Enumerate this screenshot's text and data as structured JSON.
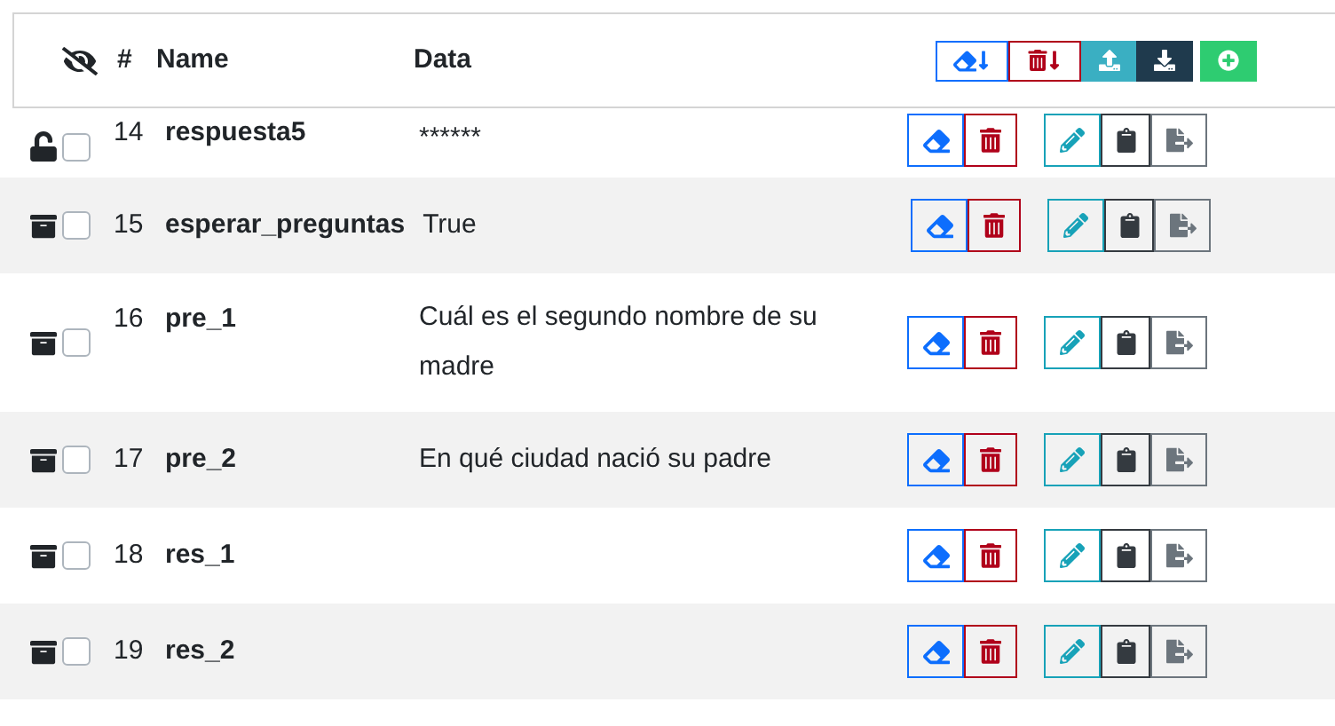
{
  "header": {
    "columns": [
      "#",
      "Name",
      "Data"
    ]
  },
  "rows": [
    {
      "kind": "unlocked",
      "checked": false,
      "number": "14",
      "name": "respuesta5",
      "data": "******"
    },
    {
      "kind": "archived",
      "checked": false,
      "number": "15",
      "name": "esperar_preguntas",
      "data": "True"
    },
    {
      "kind": "archived",
      "checked": false,
      "number": "16",
      "name": "pre_1",
      "data": "Cuál es el segundo nombre de su madre"
    },
    {
      "kind": "archived",
      "checked": false,
      "number": "17",
      "name": "pre_2",
      "data": "En qué ciudad nació su padre"
    },
    {
      "kind": "archived",
      "checked": false,
      "number": "18",
      "name": "res_1"
    },
    {
      "kind": "archived",
      "checked": false,
      "number": "19",
      "name": "res_2"
    }
  ]
}
